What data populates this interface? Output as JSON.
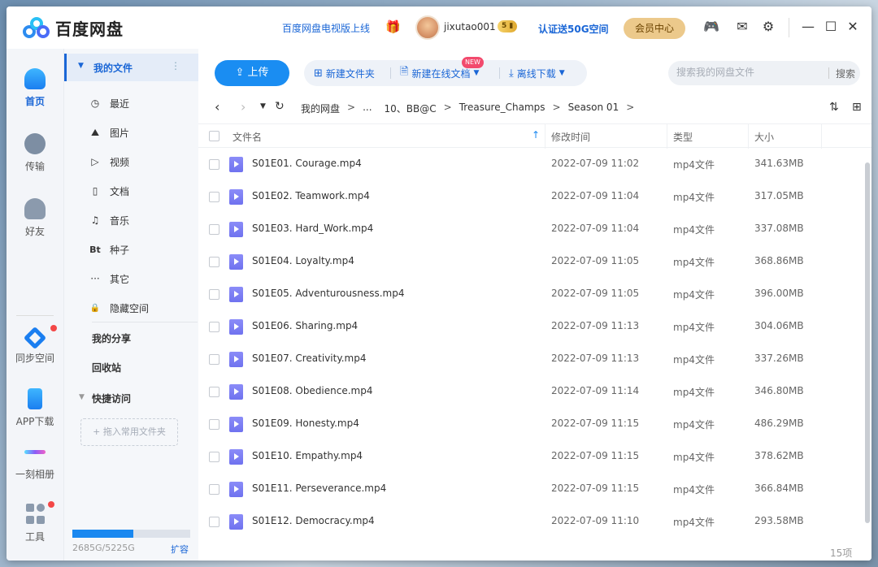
{
  "app": {
    "name": "百度网盘",
    "tv_promo": "百度网盘电视版上线",
    "username": "jixutao001",
    "vip_badge": "5",
    "verify_promo": "认证送50G空间",
    "member_center": "会员中心",
    "icons": [
      "gift-icon",
      "game-icon",
      "mail-icon",
      "settings-icon",
      "minimize-icon",
      "maximize-icon",
      "close-icon"
    ]
  },
  "rail": {
    "items": [
      {
        "label": "首页",
        "icon": "cloud-icon",
        "active": true
      },
      {
        "label": "传输",
        "icon": "transfer-icon"
      },
      {
        "label": "好友",
        "icon": "friends-icon"
      },
      {
        "label": "同步空间",
        "icon": "sync-icon"
      },
      {
        "label": "APP下载",
        "icon": "phone-icon"
      },
      {
        "label": "一刻相册",
        "icon": "album-icon"
      },
      {
        "label": "工具",
        "icon": "tools-icon"
      }
    ]
  },
  "sidebar": {
    "my_files": "我的文件",
    "more": "⋮",
    "items": [
      {
        "label": "最近",
        "icon": "clock-icon",
        "glyph": "◷"
      },
      {
        "label": "图片",
        "icon": "image-icon",
        "glyph": "⛰"
      },
      {
        "label": "视频",
        "icon": "video-icon",
        "glyph": "▷"
      },
      {
        "label": "文档",
        "icon": "document-icon",
        "glyph": "▯"
      },
      {
        "label": "音乐",
        "icon": "music-icon",
        "glyph": "♫"
      },
      {
        "label": "种子",
        "icon": "torrent-icon",
        "glyph": "Bt"
      },
      {
        "label": "其它",
        "icon": "more-icon",
        "glyph": "···"
      },
      {
        "label": "隐藏空间",
        "icon": "lock-icon",
        "glyph": "🔒"
      }
    ],
    "my_share": "我的分享",
    "recycle": "回收站",
    "quick_access": "快捷访问",
    "drop_hint": "+ 拖入常用文件夹",
    "quota": "2685G/5225G",
    "quota_fraction": 0.514,
    "expand": "扩容"
  },
  "toolbar": {
    "upload": "上传",
    "new_folder": "新建文件夹",
    "new_online_doc": "新建在线文档",
    "new_badge": "NEW",
    "offline_download": "离线下载",
    "search_placeholder": "搜索我的网盘文件",
    "search_button": "搜索"
  },
  "breadcrumb": [
    "我的网盘",
    "...",
    "10、BB@C",
    "Treasure_Champs",
    "Season 01"
  ],
  "table": {
    "columns": [
      "文件名",
      "修改时间",
      "类型",
      "大小"
    ],
    "rows": [
      {
        "name": "S01E01. Courage.mp4",
        "date": "2022-07-09 11:02",
        "type": "mp4文件",
        "size": "341.63MB"
      },
      {
        "name": "S01E02. Teamwork.mp4",
        "date": "2022-07-09 11:04",
        "type": "mp4文件",
        "size": "317.05MB"
      },
      {
        "name": "S01E03. Hard_Work.mp4",
        "date": "2022-07-09 11:04",
        "type": "mp4文件",
        "size": "337.08MB"
      },
      {
        "name": "S01E04. Loyalty.mp4",
        "date": "2022-07-09 11:05",
        "type": "mp4文件",
        "size": "368.86MB"
      },
      {
        "name": "S01E05. Adventurousness.mp4",
        "date": "2022-07-09 11:05",
        "type": "mp4文件",
        "size": "396.00MB"
      },
      {
        "name": "S01E06. Sharing.mp4",
        "date": "2022-07-09 11:13",
        "type": "mp4文件",
        "size": "304.06MB"
      },
      {
        "name": "S01E07. Creativity.mp4",
        "date": "2022-07-09 11:13",
        "type": "mp4文件",
        "size": "337.26MB"
      },
      {
        "name": "S01E08. Obedience.mp4",
        "date": "2022-07-09 11:14",
        "type": "mp4文件",
        "size": "346.80MB"
      },
      {
        "name": "S01E09. Honesty.mp4",
        "date": "2022-07-09 11:15",
        "type": "mp4文件",
        "size": "486.29MB"
      },
      {
        "name": "S01E10. Empathy.mp4",
        "date": "2022-07-09 11:15",
        "type": "mp4文件",
        "size": "378.62MB"
      },
      {
        "name": "S01E11. Perseverance.mp4",
        "date": "2022-07-09 11:15",
        "type": "mp4文件",
        "size": "366.84MB"
      },
      {
        "name": "S01E12. Democracy.mp4",
        "date": "2022-07-09 11:10",
        "type": "mp4文件",
        "size": "293.58MB"
      }
    ],
    "count": "15项"
  },
  "colors": {
    "accent": "#1a66d6",
    "upload": "#1a8df2",
    "member": "#ecc98b"
  }
}
